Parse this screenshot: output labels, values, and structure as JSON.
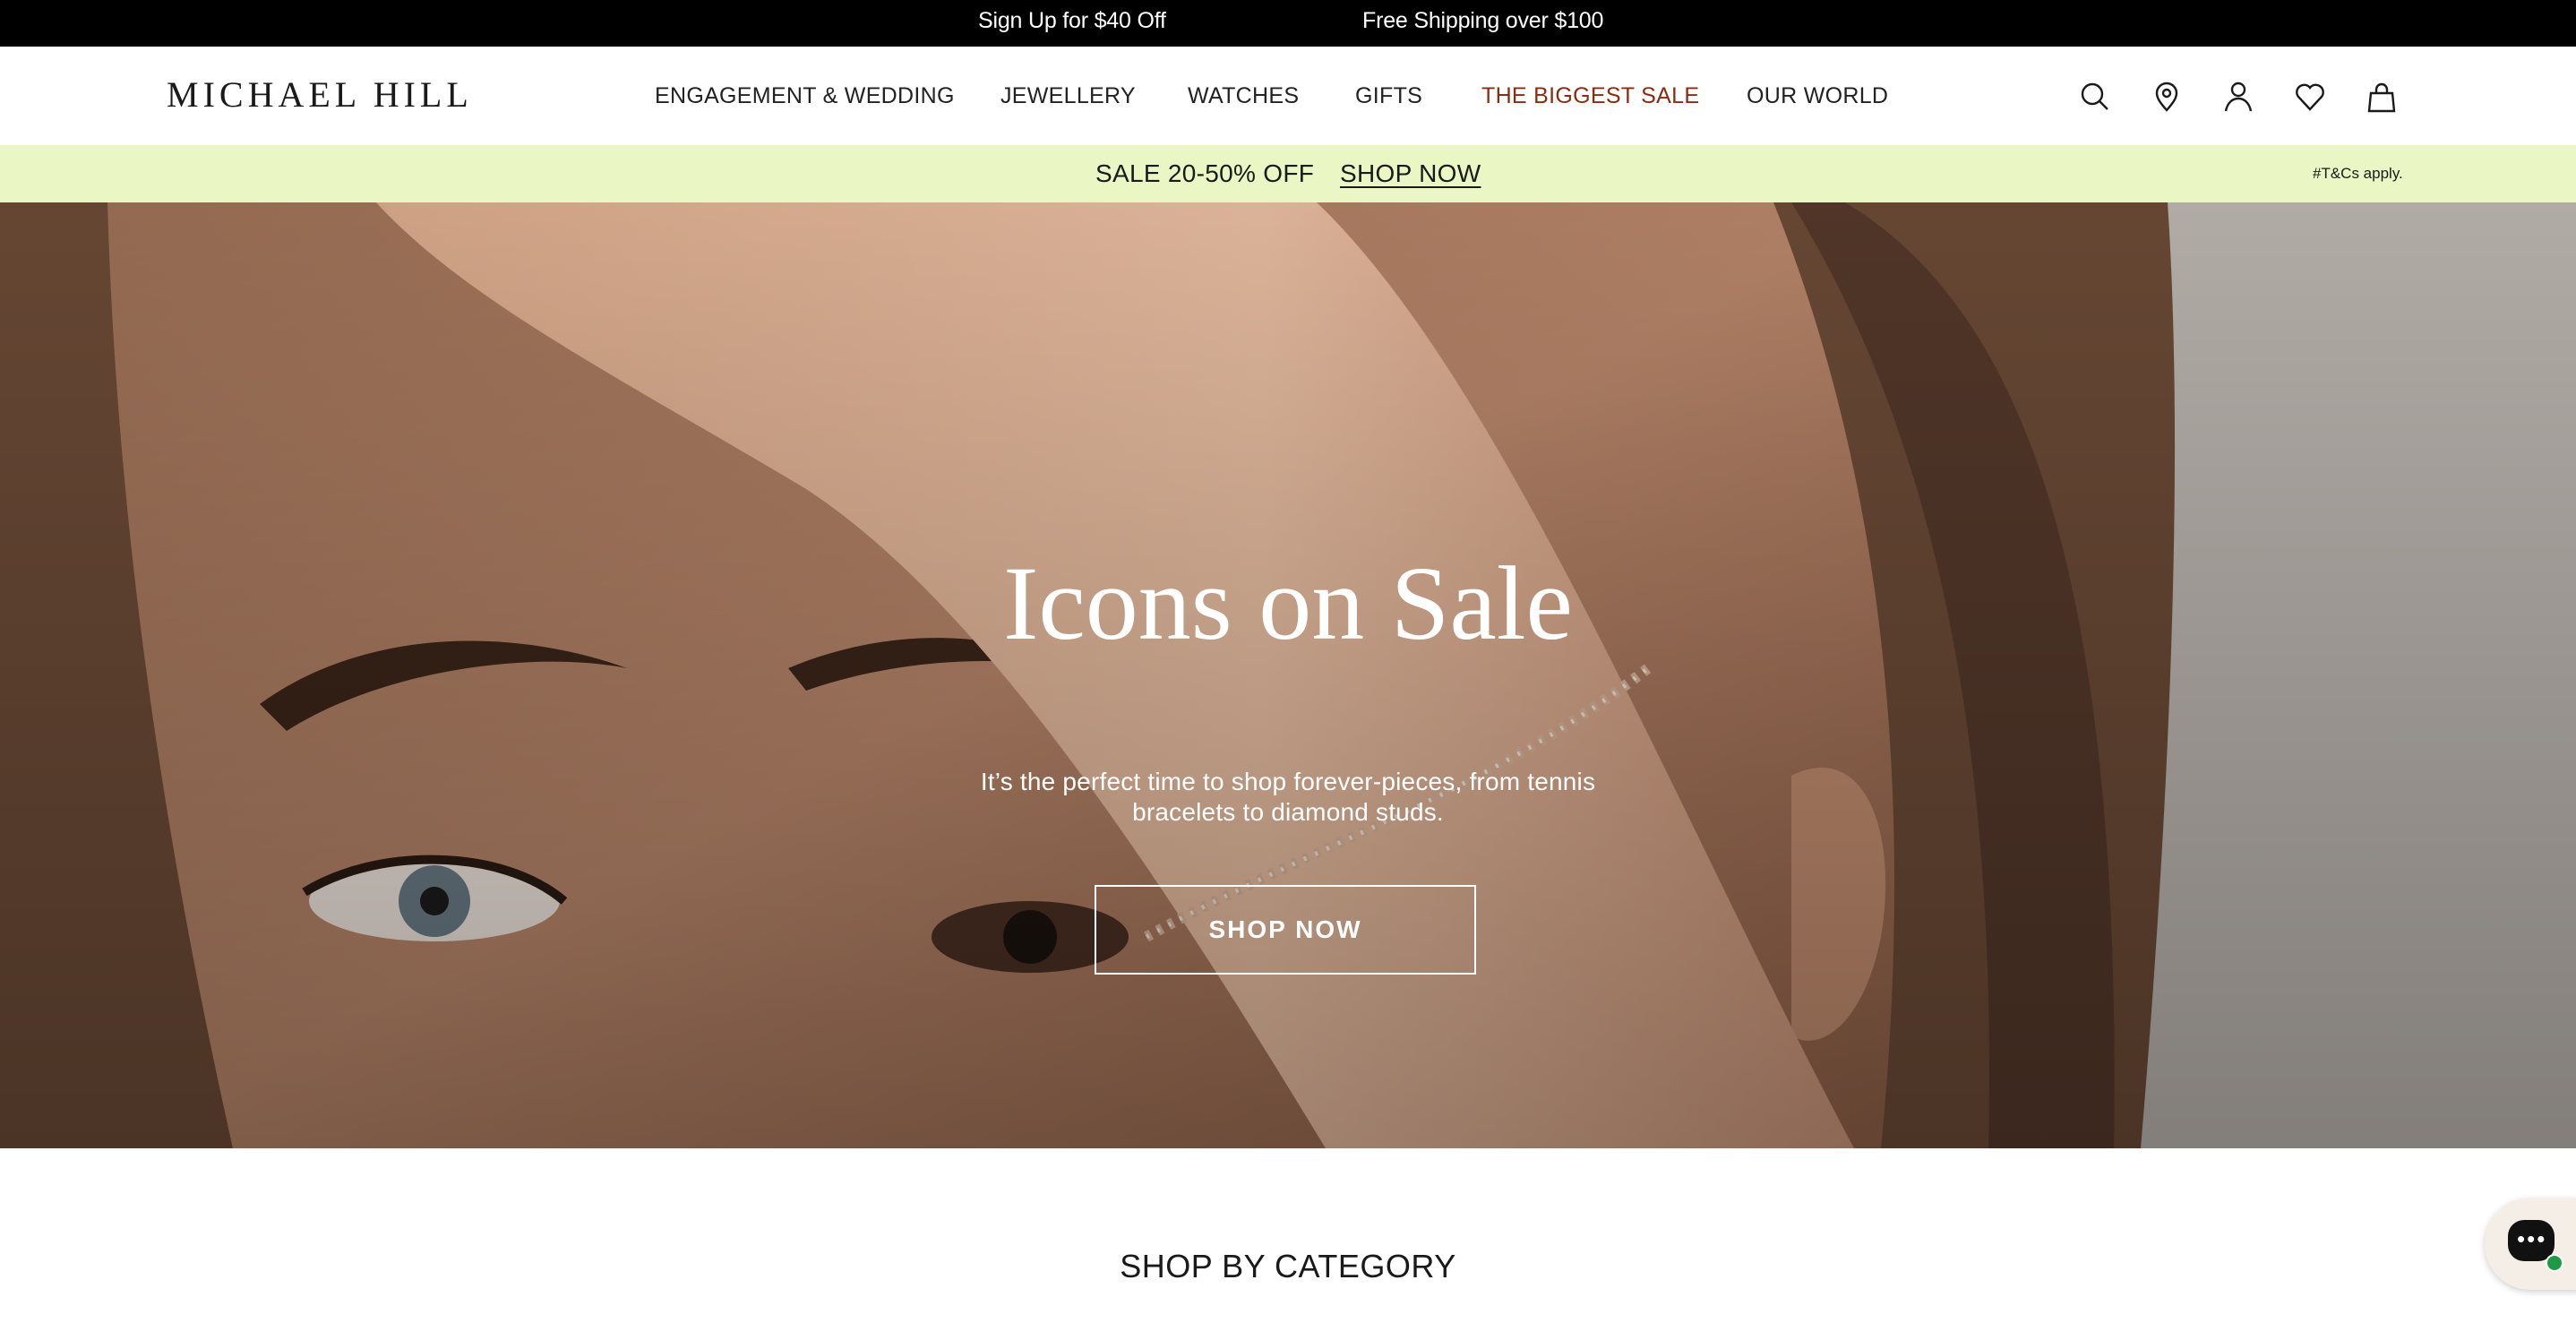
{
  "topbar": {
    "message_left": "Sign Up for $40 Off",
    "message_right": "Free Shipping over $100"
  },
  "header": {
    "logo": "MICHAEL HILL",
    "nav": [
      {
        "label": "ENGAGEMENT & WEDDING"
      },
      {
        "label": "JEWELLERY"
      },
      {
        "label": "WATCHES"
      },
      {
        "label": "GIFTS"
      },
      {
        "label": "THE BIGGEST SALE",
        "color": "#8a2c12"
      },
      {
        "label": "OUR WORLD"
      }
    ],
    "icons": [
      "search-icon",
      "location-pin-icon",
      "account-icon",
      "wishlist-heart-icon",
      "shopping-bag-icon"
    ]
  },
  "promo": {
    "text": "SALE 20-50% OFF",
    "link": "SHOP NOW",
    "terms": "#T&Cs apply.",
    "background": "#eaf7c4"
  },
  "hero": {
    "title": "Icons on Sale",
    "subtitle": "It’s the perfect time to shop forever-pieces, from tennis bracelets to diamond studs.",
    "button": "SHOP NOW"
  },
  "section": {
    "title": "SHOP BY CATEGORY"
  },
  "chat_widget": {
    "icon": "chat-bubble-icon",
    "status_color": "#1e9a45"
  }
}
